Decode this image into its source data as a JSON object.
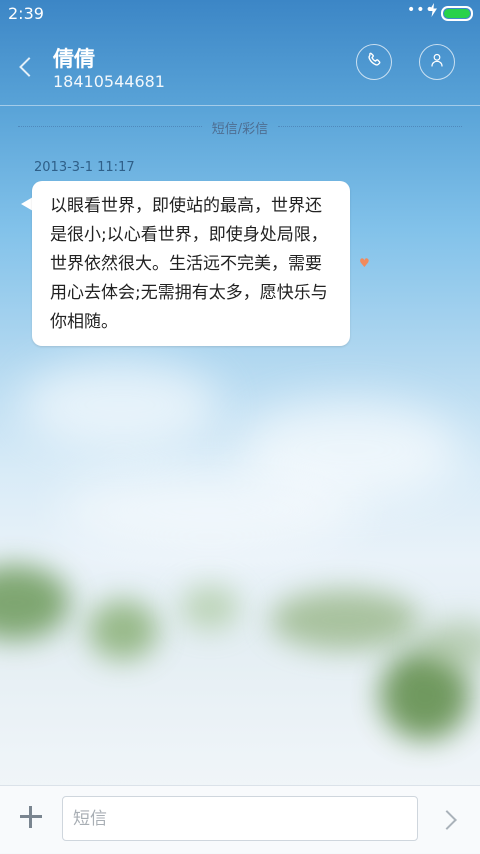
{
  "status_bar": {
    "time": "2:39",
    "dots": "•••",
    "charging_symbol": "ϟ",
    "battery_color": "#28d24a"
  },
  "header": {
    "contact_name": "倩倩",
    "contact_number": "18410544681",
    "icons": {
      "back": "chevron-left-icon",
      "call": "phone-icon",
      "profile": "person-icon"
    }
  },
  "conversation": {
    "type_label": "短信/彩信",
    "messages": [
      {
        "timestamp": "2013-3-1 11:17",
        "lines": [
          "以眼看世界，即使站的最高，世界还",
          "是很小;以心看世界，即使身处局限，",
          "世界依然很大。生活远不完美，需要",
          "用心去体会;无需拥有太多，愿快乐与",
          "你相随。"
        ],
        "favorite_icon": "heart-icon",
        "favorite_glyph": "♥"
      }
    ]
  },
  "composer": {
    "placeholder": "短信",
    "value": "",
    "icons": {
      "attach": "plus-icon",
      "send": "send-arrow-icon"
    }
  },
  "colors": {
    "accent": "#f08a5d",
    "header_blue": "#3c86c6"
  }
}
